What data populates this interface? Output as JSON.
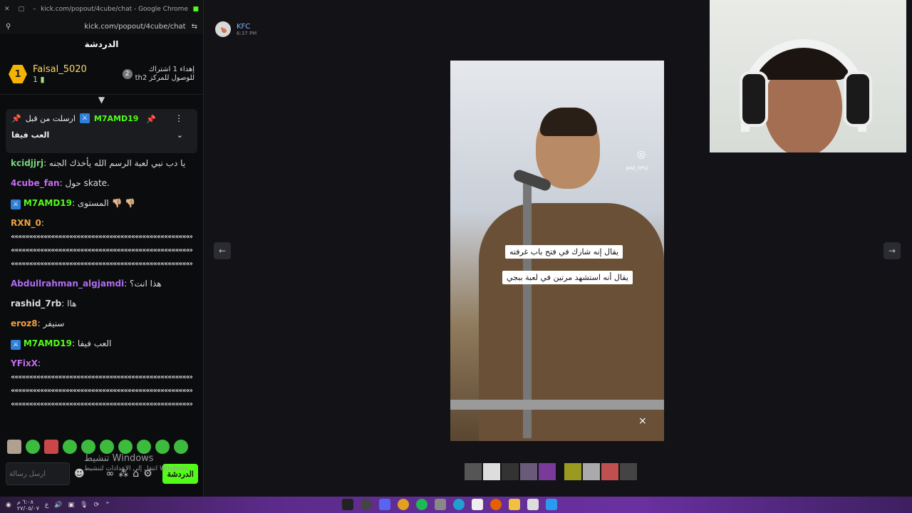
{
  "browser": {
    "window_title": "kick.com/popout/4cube/chat - Google Chrome",
    "url": "kick.com/popout/4cube/chat"
  },
  "chat": {
    "title": "الدردشة",
    "top_gifter": {
      "rank": "1",
      "name": "Faisal_5020",
      "count": "1"
    },
    "gift_goal": {
      "rank": "2",
      "line1": "إهداء 1 اشتراك",
      "line2": "thللوصول للمركز 2"
    },
    "pinned": {
      "by_label": "ارسلت من قبل",
      "user": "M7AMD19",
      "text": "العب فيفا"
    },
    "messages": [
      {
        "user": "kcidjjrj",
        "color": "#7ad67a",
        "mod": false,
        "text": "يا دب نبي لعبة الرسم الله يأخذك الجنه"
      },
      {
        "user": "4cube_fan",
        "color": "#c46cf0",
        "mod": false,
        "text": "حول skate."
      },
      {
        "user": "M7AMD19",
        "color": "#53fc18",
        "mod": true,
        "text": "المستوى 👎🏼 👎🏼"
      },
      {
        "user": "RXN_0",
        "color": "#f0a040",
        "mod": false,
        "text": ""
      },
      {
        "user": "Abdullrahman_algjamdi",
        "color": "#b06cf0",
        "mod": false,
        "text": "هذا انت؟"
      },
      {
        "user": "rashid_7rb",
        "color": "#dddddd",
        "mod": false,
        "text": "هاا"
      },
      {
        "user": "eroz8",
        "color": "#f0a040",
        "mod": false,
        "text": "سنيفر"
      },
      {
        "user": "M7AMD19",
        "color": "#53fc18",
        "mod": true,
        "text": "العب فيفا"
      },
      {
        "user": "YFixX",
        "color": "#c46cf0",
        "mod": false,
        "text": ""
      }
    ],
    "input_placeholder": "أرسل رسالة",
    "send_label": "الدردشة",
    "windows_activate": {
      "title": "تنشيط Windows",
      "sub": "انتقل إلى الإعدادات لتنشيط Windows."
    }
  },
  "viewer": {
    "author": "KFC",
    "time": "6:37 PM",
    "caption1": "يقال إنه شارك في فتح باب غرفته",
    "caption2": "يقال أنه استشهد مرتين في لعبة ببجي",
    "ig_handle": "@AE_0P52"
  },
  "taskbar": {
    "time": "٦:٠٨ م",
    "date": "٢٧/٠٥/٠٧",
    "lang": "ع"
  }
}
